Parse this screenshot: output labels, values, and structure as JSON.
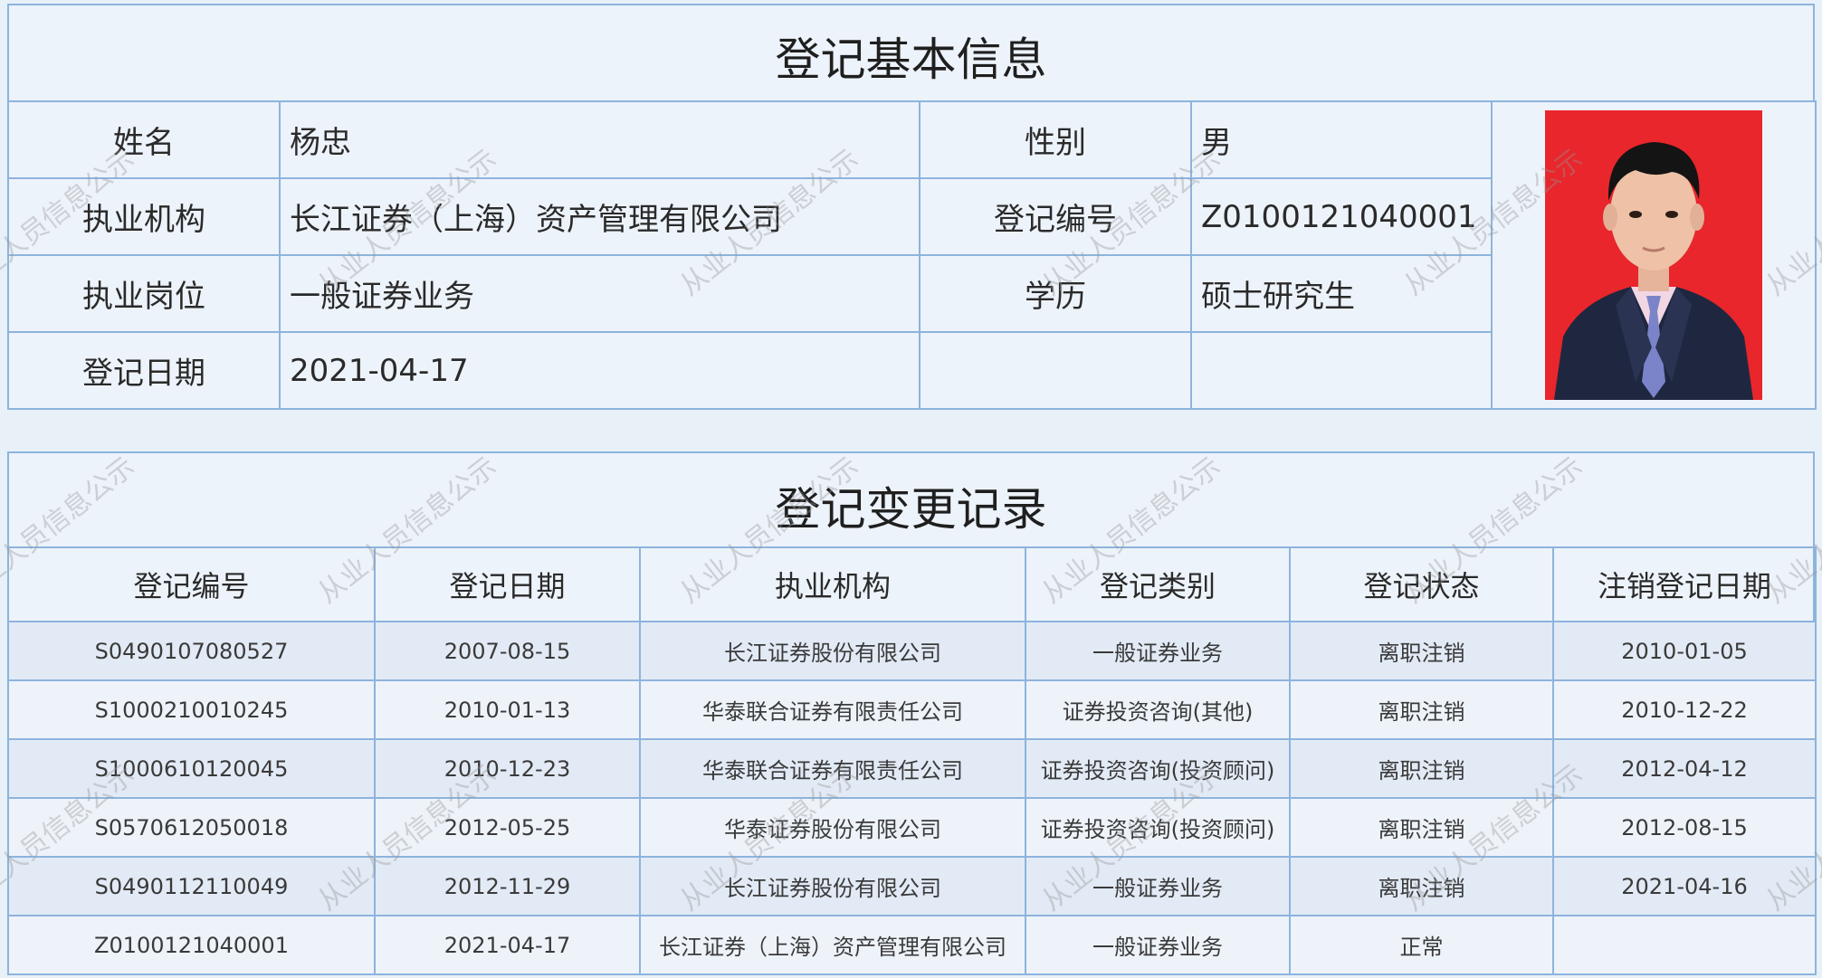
{
  "basic_info": {
    "title": "登记基本信息",
    "rows": [
      {
        "label1": "姓名",
        "value1": "杨忠",
        "label2": "性别",
        "value2": "男"
      },
      {
        "label1": "执业机构",
        "value1": "长江证券（上海）资产管理有限公司",
        "label2": "登记编号",
        "value2": "Z0100121040001"
      },
      {
        "label1": "执业岗位",
        "value1": "一般证券业务",
        "label2": "学历",
        "value2": "硕士研究生"
      },
      {
        "label1": "登记日期",
        "value1": "2021-04-17",
        "label2": "",
        "value2": ""
      }
    ]
  },
  "change_records": {
    "title": "登记变更记录",
    "headers": [
      "登记编号",
      "登记日期",
      "执业机构",
      "登记类别",
      "登记状态",
      "注销登记日期"
    ],
    "rows": [
      [
        "S0490107080527",
        "2007-08-15",
        "长江证券股份有限公司",
        "一般证券业务",
        "离职注销",
        "2010-01-05"
      ],
      [
        "S1000210010245",
        "2010-01-13",
        "华泰联合证券有限责任公司",
        "证券投资咨询(其他)",
        "离职注销",
        "2010-12-22"
      ],
      [
        "S1000610120045",
        "2010-12-23",
        "华泰联合证券有限责任公司",
        "证券投资咨询(投资顾问)",
        "离职注销",
        "2012-04-12"
      ],
      [
        "S0570612050018",
        "2012-05-25",
        "华泰证券股份有限公司",
        "证券投资咨询(投资顾问)",
        "离职注销",
        "2012-08-15"
      ],
      [
        "S0490112110049",
        "2012-11-29",
        "长江证券股份有限公司",
        "一般证券业务",
        "离职注销",
        "2021-04-16"
      ],
      [
        "Z0100121040001",
        "2021-04-17",
        "长江证券（上海）资产管理有限公司",
        "一般证券业务",
        "正常",
        ""
      ]
    ]
  },
  "watermark": {
    "text": "从业人员信息公示"
  },
  "colors": {
    "border": "#8db4dd",
    "photo_background": "#e8262b",
    "panel_background": "#edf3fa"
  }
}
